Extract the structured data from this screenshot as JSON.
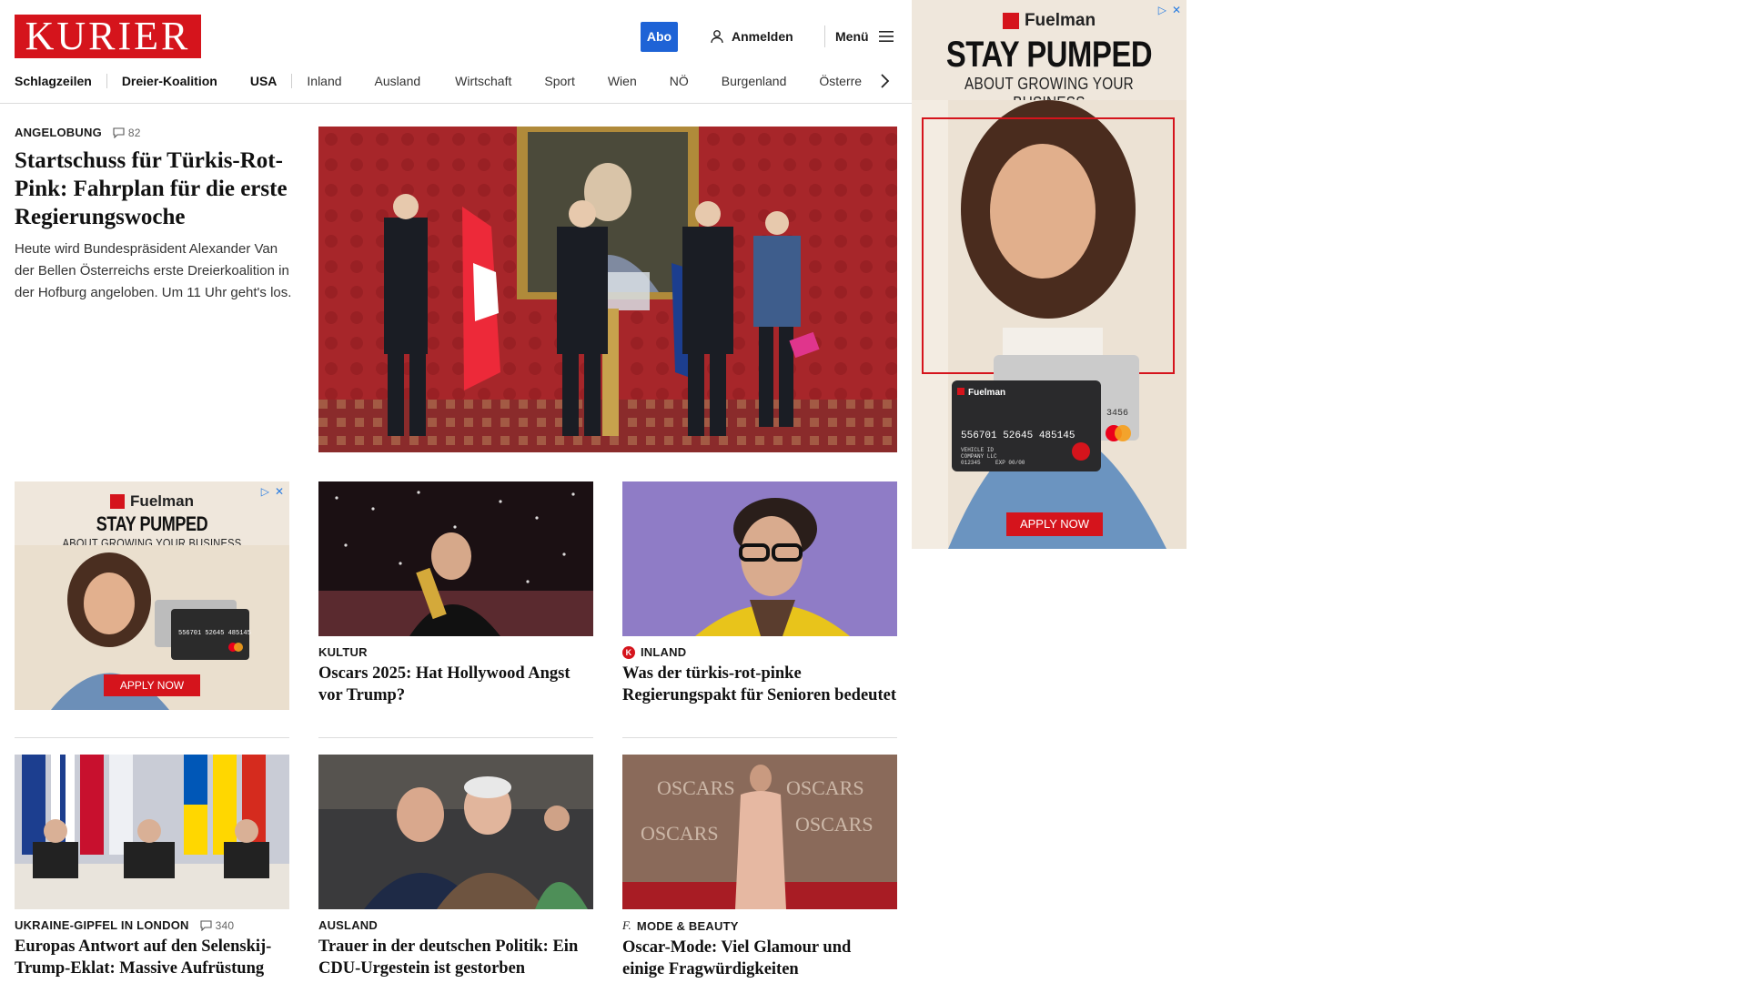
{
  "header": {
    "logo": "KURIER",
    "abo_label": "Abo",
    "login_label": "Anmelden",
    "menu_label": "Menü"
  },
  "nav": {
    "items": [
      "Schlagzeilen",
      "Dreier-Koalition",
      "USA",
      "Inland",
      "Ausland",
      "Wirtschaft",
      "Sport",
      "Wien",
      "NÖ",
      "Burgenland",
      "Österre"
    ]
  },
  "lead": {
    "kicker": "ANGELOBUNG",
    "comments": "82",
    "headline": "Startschuss für Türkis-Rot-Pink: Fahrplan für die erste Regierungswoche",
    "teaser": "Heute wird Bundespräsident Alexander Van der Bellen Österreichs erste Dreierkoalition in der Hofburg angeloben. Um 11 Uhr geht's los."
  },
  "cards": [
    {
      "kicker": "KULTUR",
      "headline": "Oscars 2025: Hat Hollywood Angst vor Trump?"
    },
    {
      "kicker": "INLAND",
      "headline": "Was der türkis-rot-pinke Regierungspakt für Senioren bedeutet"
    },
    {
      "kicker": "UKRAINE-GIPFEL IN LONDON",
      "comments": "340",
      "headline": "Europas Antwort auf den Selenskij-Trump-Eklat: Massive Aufrüstung"
    },
    {
      "kicker": "AUSLAND",
      "headline": "Trauer in der deutschen Politik: Ein CDU-Urgestein ist gestorben"
    },
    {
      "kicker": "MODE & BEAUTY",
      "headline": "Oscar-Mode: Viel Glamour und einige Fragwürdigkeiten"
    }
  ],
  "ad": {
    "brand": "Fuelman",
    "title": "STAY PUMPED",
    "subtitle": "ABOUT GROWING YOUR BUSINESS",
    "button": "APPLY NOW",
    "card_number": "556701 52645 485145",
    "card_vehicle": "VEHICLE ID",
    "card_company": "COMPANY LLC",
    "card_code": "012345",
    "card_exp": "EXP 00/00",
    "card_back": "3456"
  },
  "colors": {
    "brand_red": "#d5141c",
    "abo_blue": "#1e63d6"
  }
}
